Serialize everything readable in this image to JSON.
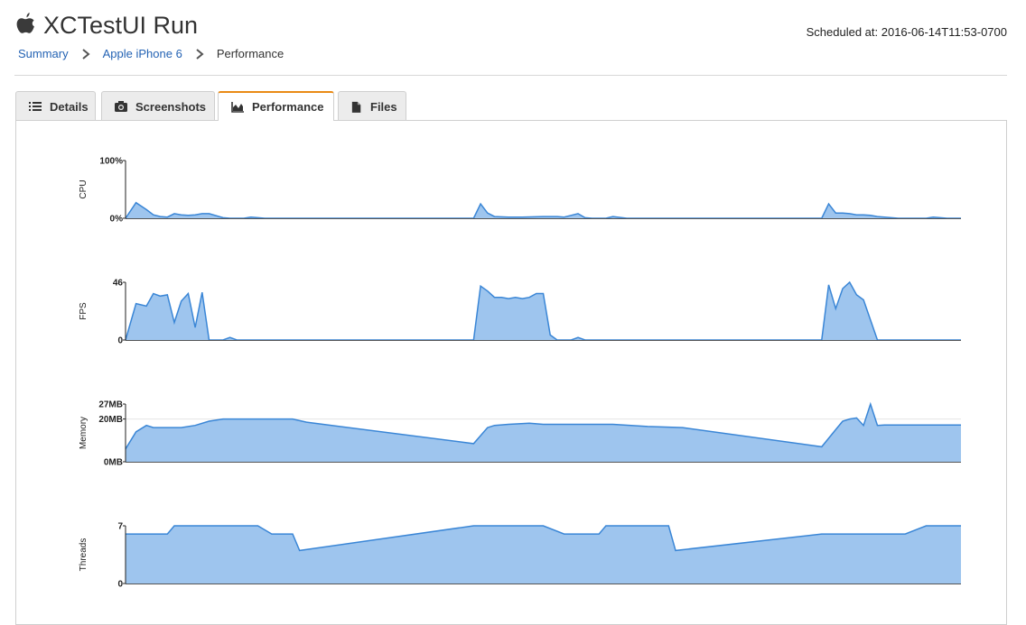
{
  "header": {
    "title": "XCTestUI Run",
    "scheduled": "Scheduled at: 2016-06-14T11:53-0700"
  },
  "breadcrumb": [
    {
      "label": "Summary",
      "link": true
    },
    {
      "label": "Apple iPhone 6",
      "link": true
    },
    {
      "label": "Performance",
      "link": false
    }
  ],
  "tabs": [
    {
      "label": "Details",
      "icon": "list-icon",
      "active": false
    },
    {
      "label": "Screenshots",
      "icon": "camera-icon",
      "active": false
    },
    {
      "label": "Performance",
      "icon": "area-chart-icon",
      "active": true
    },
    {
      "label": "Files",
      "icon": "file-icon",
      "active": false
    }
  ],
  "colors": {
    "accent_tab": "#e98a15",
    "link": "#2463b4",
    "area_fill": "#9ec5ee",
    "area_stroke": "#3a86d6"
  },
  "chart_data": [
    {
      "type": "area",
      "ylabel": "CPU",
      "ytick_labels": [
        "100%",
        "0%"
      ],
      "ylim": [
        0,
        100
      ],
      "x": [
        0,
        1.5,
        3,
        4,
        5,
        6,
        7,
        8,
        9,
        10,
        11,
        12,
        14,
        15,
        16,
        17,
        18,
        20,
        22,
        24,
        26,
        28,
        30,
        40,
        50,
        51,
        52,
        53,
        55,
        57,
        60,
        62,
        63,
        64,
        65,
        66,
        67,
        68,
        69,
        70,
        72,
        75,
        80,
        90,
        100,
        101,
        102,
        103,
        104,
        105,
        106,
        107,
        108,
        109,
        110,
        111,
        112,
        113,
        114,
        115,
        116,
        117,
        118,
        119,
        120
      ],
      "values": [
        0,
        27,
        15,
        6,
        3,
        2,
        8,
        6,
        5,
        6,
        8,
        8,
        1,
        0,
        0,
        0,
        2,
        0,
        0,
        0,
        0,
        0,
        0,
        0,
        0,
        25,
        9,
        3,
        2,
        2,
        3,
        3,
        2,
        5,
        8,
        1,
        0,
        0,
        0,
        3,
        0,
        0,
        0,
        0,
        0,
        25,
        9,
        9,
        8,
        6,
        6,
        5,
        3,
        2,
        1,
        0,
        0,
        0,
        0,
        0,
        2,
        1,
        0,
        0,
        0
      ]
    },
    {
      "type": "area",
      "ylabel": "FPS",
      "ytick_labels": [
        "46",
        "0"
      ],
      "ylim": [
        0,
        46
      ],
      "x": [
        0,
        1.5,
        3,
        4,
        5,
        6,
        7,
        8,
        9,
        10,
        11,
        12,
        13,
        14,
        15,
        16,
        17,
        18,
        19,
        20,
        21,
        22,
        30,
        40,
        50,
        51,
        52,
        53,
        54,
        55,
        56,
        57,
        58,
        59,
        60,
        61,
        62,
        63,
        64,
        65,
        66,
        67,
        68,
        69,
        70,
        80,
        90,
        100,
        101,
        102,
        103,
        104,
        105,
        106,
        107,
        108,
        109,
        110,
        111,
        112,
        113,
        114,
        115,
        116,
        117,
        118,
        119,
        120
      ],
      "values": [
        0,
        29,
        27,
        37,
        35,
        36,
        14,
        31,
        37,
        10,
        38,
        0,
        0,
        0,
        2,
        0,
        0,
        0,
        0,
        0,
        0,
        0,
        0,
        0,
        0,
        43,
        39,
        34,
        34,
        33,
        34,
        33,
        34,
        37,
        37,
        4,
        0,
        0,
        0,
        2,
        0,
        0,
        0,
        0,
        0,
        0,
        0,
        0,
        44,
        25,
        41,
        46,
        36,
        32,
        16,
        0,
        0,
        0,
        0,
        0,
        0,
        0,
        0,
        0,
        0,
        0,
        0,
        0
      ]
    },
    {
      "type": "area",
      "ylabel": "Memory",
      "ytick_labels": [
        "27MB",
        "20MB",
        "0MB"
      ],
      "ylim": [
        0,
        27
      ],
      "x": [
        0,
        1.5,
        3,
        4,
        6,
        8,
        10,
        12,
        14,
        16,
        18,
        20,
        22,
        24,
        26,
        50,
        52,
        53,
        55,
        58,
        60,
        62,
        65,
        70,
        75,
        80,
        100,
        102,
        103,
        104,
        105,
        106,
        107,
        108,
        109,
        110,
        112,
        115,
        120
      ],
      "values": [
        6,
        14,
        17,
        16,
        16,
        16,
        17,
        19,
        20,
        20,
        20,
        20,
        20,
        20,
        18.5,
        8.5,
        16,
        17,
        17.5,
        18,
        17.5,
        17.5,
        17.5,
        17.5,
        16.5,
        16,
        7,
        15,
        19,
        20,
        20.5,
        17,
        27,
        17,
        17.2,
        17.2,
        17.2,
        17.2,
        17.2
      ]
    },
    {
      "type": "area",
      "ylabel": "Threads",
      "ytick_labels": [
        "7",
        "0"
      ],
      "ylim": [
        0,
        7
      ],
      "x": [
        0,
        6,
        7,
        12,
        19,
        21,
        24,
        25,
        50,
        55,
        60,
        63,
        65,
        68,
        69,
        70,
        72,
        75,
        78,
        79,
        100,
        112,
        115,
        120
      ],
      "values": [
        6,
        6,
        7,
        7,
        7,
        6,
        6,
        4,
        7,
        7,
        7,
        6,
        6,
        6,
        7,
        7,
        7,
        7,
        7,
        4,
        6,
        6,
        7,
        7
      ]
    }
  ]
}
